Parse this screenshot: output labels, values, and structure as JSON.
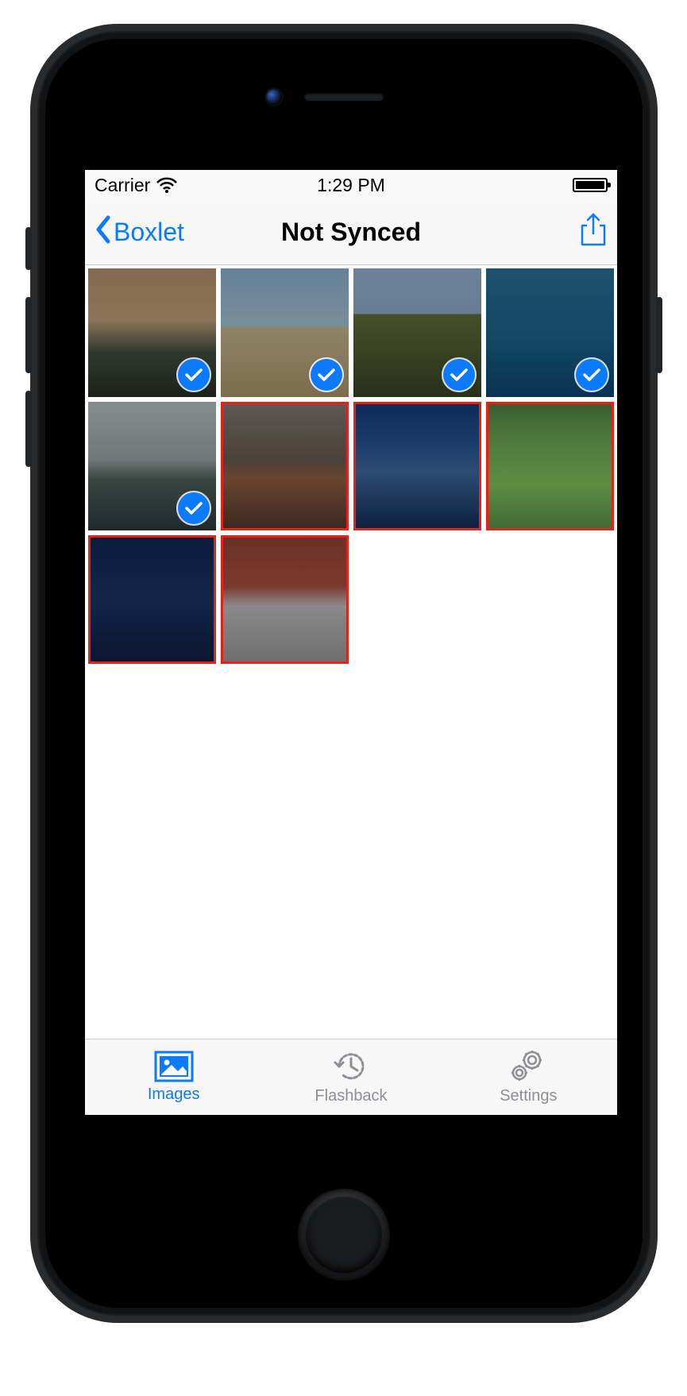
{
  "status": {
    "carrier": "Carrier",
    "time": "1:29 PM"
  },
  "nav": {
    "back_label": "Boxlet",
    "title": "Not Synced"
  },
  "thumbs": [
    {
      "selected": true,
      "flagged": false
    },
    {
      "selected": true,
      "flagged": false
    },
    {
      "selected": true,
      "flagged": false
    },
    {
      "selected": true,
      "flagged": false
    },
    {
      "selected": true,
      "flagged": false
    },
    {
      "selected": false,
      "flagged": true
    },
    {
      "selected": false,
      "flagged": true
    },
    {
      "selected": false,
      "flagged": true
    },
    {
      "selected": false,
      "flagged": true
    },
    {
      "selected": false,
      "flagged": true
    }
  ],
  "tabs": {
    "images": "Images",
    "flashback": "Flashback",
    "settings": "Settings"
  },
  "colors": {
    "accent": "#0b7aff",
    "flag": "#e2231a"
  }
}
